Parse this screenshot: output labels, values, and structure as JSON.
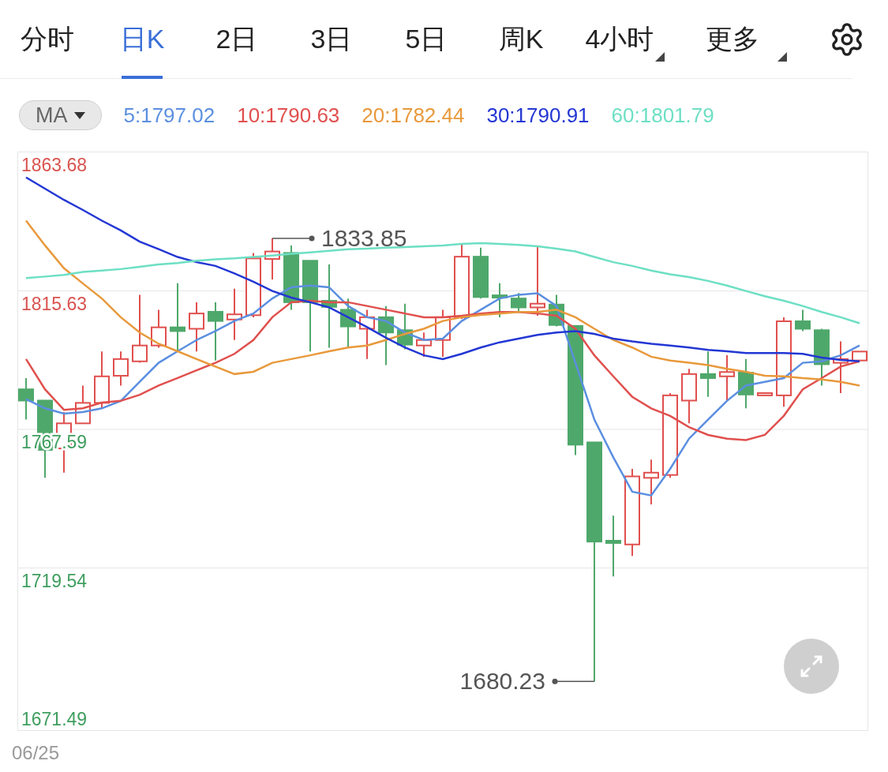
{
  "tabs": [
    {
      "label": "分时",
      "selected": false,
      "dropdown": false
    },
    {
      "label": "日K",
      "selected": true,
      "dropdown": false
    },
    {
      "label": "2日",
      "selected": false,
      "dropdown": false
    },
    {
      "label": "3日",
      "selected": false,
      "dropdown": false
    },
    {
      "label": "5日",
      "selected": false,
      "dropdown": false
    },
    {
      "label": "周K",
      "selected": false,
      "dropdown": false
    },
    {
      "label": "4小时",
      "selected": false,
      "dropdown": true
    },
    {
      "label": "更多",
      "selected": false,
      "dropdown": true
    }
  ],
  "indicator_select": {
    "value": "MA"
  },
  "chart": {
    "chart_data": {
      "type": "line",
      "grid": true,
      "ylim": [
        1663.3,
        1863.68
      ],
      "yticks": [
        {
          "value": 1863.68,
          "label": "1863.68"
        },
        {
          "value": 1815.63,
          "label": "1815.63"
        },
        {
          "value": 1767.59,
          "label": "1767.59"
        },
        {
          "value": 1719.54,
          "label": "1719.54"
        },
        {
          "value": 1671.49,
          "label": "1671.49"
        }
      ],
      "series": [
        {
          "name": "5:1797.02",
          "color": "#5b8fe0",
          "values": [
            1778.1,
            1774.9,
            1773.1,
            1773.6,
            1774.9,
            1777.5,
            1784.1,
            1790.7,
            1794.7,
            1798.6,
            1801.7,
            1805.2,
            1807.8,
            1813.0,
            1816.9,
            1817.5,
            1816.9,
            1810.4,
            1806.5,
            1805.2,
            1801.2,
            1798.6,
            1799.1,
            1805.2,
            1809.1,
            1813.0,
            1814.3,
            1814.8,
            1810.4,
            1790.7,
            1771.0,
            1757.9,
            1746.0,
            1744.7,
            1753.9,
            1764.4,
            1771.0,
            1777.5,
            1782.8,
            1784.1,
            1785.4,
            1790.7,
            1791.2,
            1793.3,
            1796.7
          ]
        },
        {
          "name": "10:1790.63",
          "color": "#e0504e",
          "values": [
            1792.0,
            1781.5,
            1774.4,
            1774.9,
            1776.9,
            1777.5,
            1779.6,
            1782.8,
            1785.4,
            1788.1,
            1790.7,
            1793.8,
            1798.6,
            1806.5,
            1811.7,
            1812.2,
            1811.7,
            1811.7,
            1810.4,
            1809.1,
            1807.8,
            1806.5,
            1806.5,
            1807.0,
            1807.8,
            1808.3,
            1808.3,
            1807.8,
            1807.0,
            1802.5,
            1793.3,
            1786.0,
            1778.9,
            1774.9,
            1772.3,
            1768.4,
            1765.7,
            1764.4,
            1763.9,
            1765.7,
            1772.3,
            1781.5,
            1785.4,
            1789.4,
            1791.2
          ]
        },
        {
          "name": "20:1782.44",
          "color": "#e8993c",
          "values": [
            1840.0,
            1831.4,
            1823.5,
            1818.2,
            1813.0,
            1806.5,
            1801.2,
            1797.3,
            1794.7,
            1792.0,
            1789.4,
            1786.8,
            1787.6,
            1790.7,
            1792.0,
            1793.3,
            1794.7,
            1796.0,
            1796.7,
            1798.6,
            1800.7,
            1802.5,
            1805.2,
            1806.5,
            1807.3,
            1807.8,
            1808.3,
            1808.3,
            1809.1,
            1806.5,
            1802.5,
            1798.6,
            1796.0,
            1792.8,
            1791.5,
            1790.7,
            1789.9,
            1788.6,
            1787.6,
            1786.2,
            1786.0,
            1785.4,
            1784.9,
            1784.1,
            1782.8
          ]
        },
        {
          "name": "30:1790.91",
          "color": "#2337d4",
          "values": [
            1855.0,
            1851.1,
            1847.2,
            1843.7,
            1840.0,
            1836.6,
            1832.7,
            1830.1,
            1827.4,
            1825.6,
            1824.3,
            1821.7,
            1818.8,
            1815.6,
            1813.3,
            1811.7,
            1809.9,
            1806.5,
            1803.1,
            1799.4,
            1796.0,
            1793.3,
            1792.0,
            1793.8,
            1796.0,
            1797.8,
            1799.1,
            1800.4,
            1801.2,
            1801.7,
            1800.7,
            1799.1,
            1798.1,
            1797.3,
            1796.7,
            1796.0,
            1795.2,
            1794.7,
            1794.1,
            1794.1,
            1794.1,
            1793.8,
            1792.5,
            1791.7,
            1791.2
          ]
        },
        {
          "name": "60:1801.79",
          "color": "#6ddfc4",
          "values": [
            1820.1,
            1820.6,
            1821.2,
            1822.2,
            1822.7,
            1823.2,
            1824.0,
            1824.8,
            1825.3,
            1826.1,
            1826.6,
            1826.9,
            1827.4,
            1827.9,
            1828.5,
            1829.0,
            1829.5,
            1830.1,
            1830.3,
            1830.6,
            1830.8,
            1831.1,
            1831.4,
            1831.9,
            1832.2,
            1831.9,
            1831.6,
            1831.1,
            1830.3,
            1829.3,
            1827.4,
            1825.6,
            1824.3,
            1822.7,
            1821.4,
            1820.4,
            1819.1,
            1817.5,
            1815.6,
            1813.8,
            1812.2,
            1810.4,
            1808.3,
            1806.5,
            1804.4
          ]
        }
      ],
      "annotations": [
        {
          "text": "1833.85"
        },
        {
          "text": "1680.23"
        }
      ]
    }
  },
  "date_label": "06/25"
}
